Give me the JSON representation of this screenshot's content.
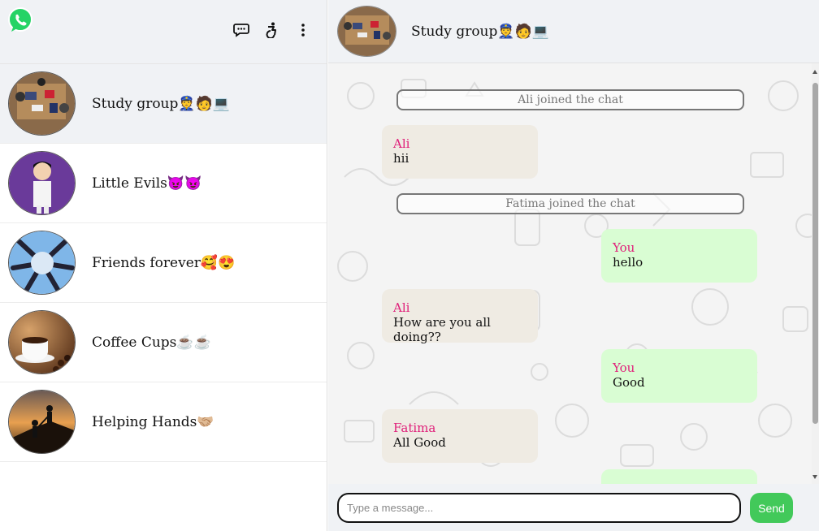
{
  "sidebar": {
    "chats": [
      {
        "name": "Study group👮🧑💻"
      },
      {
        "name": "Little Evils😈😈"
      },
      {
        "name": "Friends forever🥰😍"
      },
      {
        "name": "Coffee Cups☕☕"
      },
      {
        "name": "Helping Hands🤝🏼"
      }
    ]
  },
  "chat": {
    "title": "Study group👮🧑💻",
    "messages": [
      {
        "type": "system",
        "text": "Ali joined the chat"
      },
      {
        "type": "in",
        "sender": "Ali",
        "text": "hii"
      },
      {
        "type": "system",
        "text": "Fatima joined the chat"
      },
      {
        "type": "out",
        "sender": "You",
        "text": "hello"
      },
      {
        "type": "in",
        "sender": "Ali",
        "text": "How are you all doing??"
      },
      {
        "type": "out",
        "sender": "You",
        "text": "Good"
      },
      {
        "type": "in",
        "sender": "Fatima",
        "text": "All Good"
      }
    ]
  },
  "composer": {
    "placeholder": "Type a message...",
    "send_label": "Send"
  },
  "colors": {
    "brand_green": "#25d366",
    "send_green": "#42c95a",
    "sender_pink": "#e0207a",
    "incoming_bubble": "#efebe3",
    "outgoing_bubble": "#d9fdd3"
  },
  "icons": [
    "whatsapp-logo",
    "new-chat-icon",
    "accessibility-icon",
    "more-options-icon"
  ]
}
